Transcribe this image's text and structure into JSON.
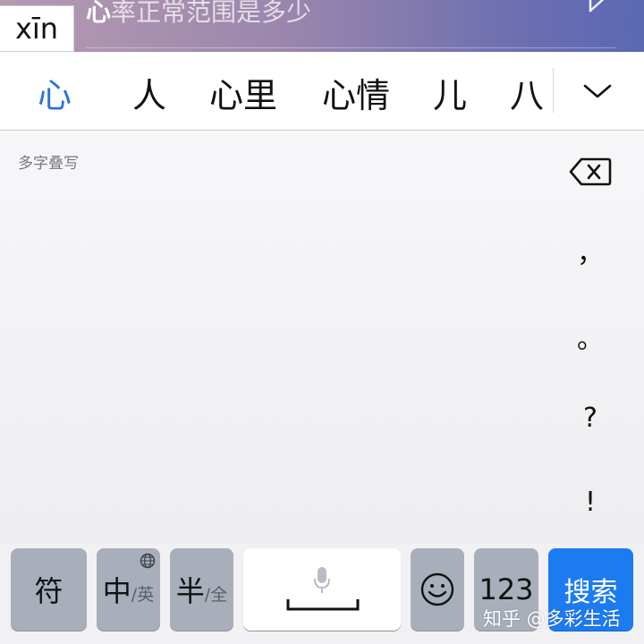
{
  "search": {
    "query_first_char": "心",
    "query_rest": "率正常范围是多少"
  },
  "ime": {
    "pinyin": "xīn"
  },
  "candidates": [
    {
      "text": "心",
      "selected": true
    },
    {
      "text": "人",
      "selected": false
    },
    {
      "text": "心里",
      "selected": false
    },
    {
      "text": "心情",
      "selected": false
    },
    {
      "text": "儿",
      "selected": false
    },
    {
      "text": "八",
      "selected": false
    }
  ],
  "handwriting": {
    "hint": "多字叠写",
    "punctuation": [
      "，",
      "。",
      "?",
      "!"
    ]
  },
  "keys": {
    "symbols": "符",
    "chinese_main": "中",
    "chinese_alt": "/英",
    "half_main": "半",
    "half_alt": "/全",
    "numbers": "123",
    "search": "搜索"
  },
  "watermark": "知乎 @多彩生活",
  "colors": {
    "accent": "#2b73d8",
    "search_key": "#1d7bf2",
    "function_key": "#a8afba"
  }
}
